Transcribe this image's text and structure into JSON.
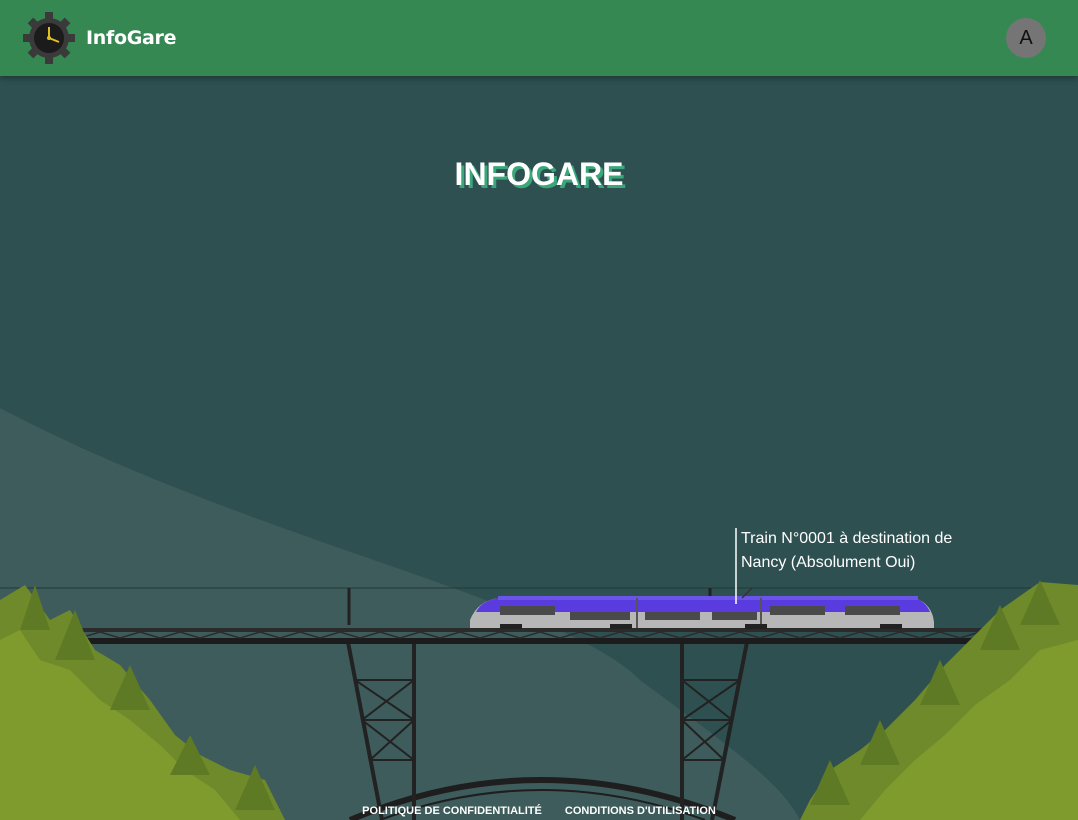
{
  "header": {
    "app_name": "InfoGare",
    "avatar_letter": "A"
  },
  "hero": {
    "title": "INFOGARE"
  },
  "train": {
    "info_line1": "Train N°0001 à destination de",
    "info_line2": "Nancy (Absolument Oui)"
  },
  "footer": {
    "privacy": "POLITIQUE DE CONFIDENTIALITÉ",
    "terms": "CONDITIONS D'UTILISATION"
  },
  "colors": {
    "appbar": "#358852",
    "background": "#2e5050",
    "hill": "#3d5c5b",
    "forest": "#7a8a2a",
    "train_accent": "#5a3be0"
  },
  "icons": {
    "logo": "clock-gear-icon"
  }
}
